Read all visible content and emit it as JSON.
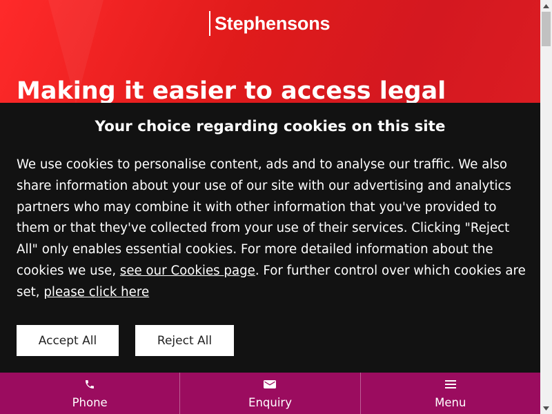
{
  "brand": {
    "name": "Stephensons"
  },
  "hero": {
    "title": "Making it easier to access legal"
  },
  "cookie_banner": {
    "title": "Your choice regarding cookies on this site",
    "text_part1": "We use cookies to personalise content, ads and to analyse our traffic. We also share information about your use of our site with our advertising and analytics partners who may combine it with other information that you've provided to them or that they've collected from your use of their services. Clicking \"Reject All\" only enables essential cookies. For more detailed information about the cookies we use, ",
    "link1": "see our Cookies page",
    "text_part2": ". For further control over which cookies are set, ",
    "link2": "please click here",
    "accept_label": "Accept All",
    "reject_label": "Reject All"
  },
  "bottom_nav": {
    "items": [
      {
        "label": "Phone",
        "icon": "phone-icon"
      },
      {
        "label": "Enquiry",
        "icon": "mail-icon"
      },
      {
        "label": "Menu",
        "icon": "hamburger-icon"
      }
    ]
  },
  "colors": {
    "hero_red": "#e01b1b",
    "banner_bg": "#121212",
    "nav_bg": "#9b0c5f"
  }
}
